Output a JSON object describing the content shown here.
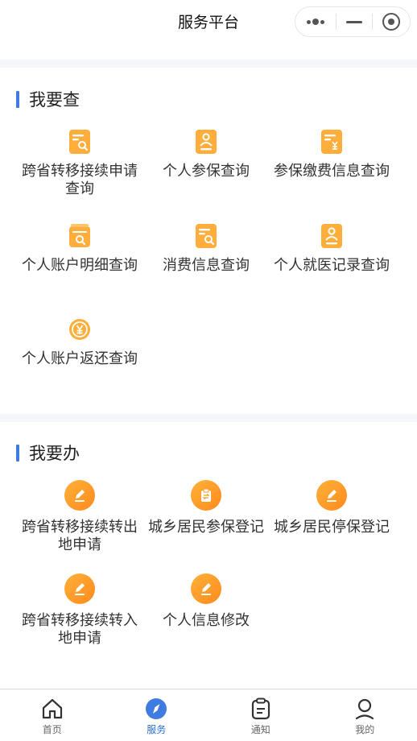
{
  "header": {
    "title": "服务平台"
  },
  "query_section": {
    "title": "我要查",
    "items": [
      {
        "label": "跨省转移接续申请查询",
        "icon": "doc-search-icon"
      },
      {
        "label": "个人参保查询",
        "icon": "doc-person-icon"
      },
      {
        "label": "参保缴费信息查询",
        "icon": "doc-yen-icon"
      },
      {
        "label": "个人账户明细查询",
        "icon": "wallet-search-icon"
      },
      {
        "label": "消费信息查询",
        "icon": "doc-search-icon"
      },
      {
        "label": "个人就医记录查询",
        "icon": "doc-person-icon"
      },
      {
        "label": "个人账户返还查询",
        "icon": "yen-return-icon"
      }
    ]
  },
  "action_section": {
    "title": "我要办",
    "items": [
      {
        "label": "跨省转移接续转出地申请",
        "icon": "pencil-icon"
      },
      {
        "label": "城乡居民参保登记",
        "icon": "clipboard-icon"
      },
      {
        "label": "城乡居民停保登记",
        "icon": "pencil-icon"
      },
      {
        "label": "跨省转移接续转入地申请",
        "icon": "pencil-icon"
      },
      {
        "label": "个人信息修改",
        "icon": "pencil-icon"
      }
    ]
  },
  "tabbar": {
    "active_index": 1,
    "accent_color": "#2b6fd8",
    "tabs": [
      {
        "label": "首页",
        "icon": "home-icon"
      },
      {
        "label": "服务",
        "icon": "compass-icon"
      },
      {
        "label": "通知",
        "icon": "clipboard-icon"
      },
      {
        "label": "我的",
        "icon": "user-icon"
      }
    ]
  },
  "colors": {
    "section_accent": "#3f7be0",
    "icon_orange": "#ff9a2a",
    "background_gap": "#f5f6fa"
  }
}
